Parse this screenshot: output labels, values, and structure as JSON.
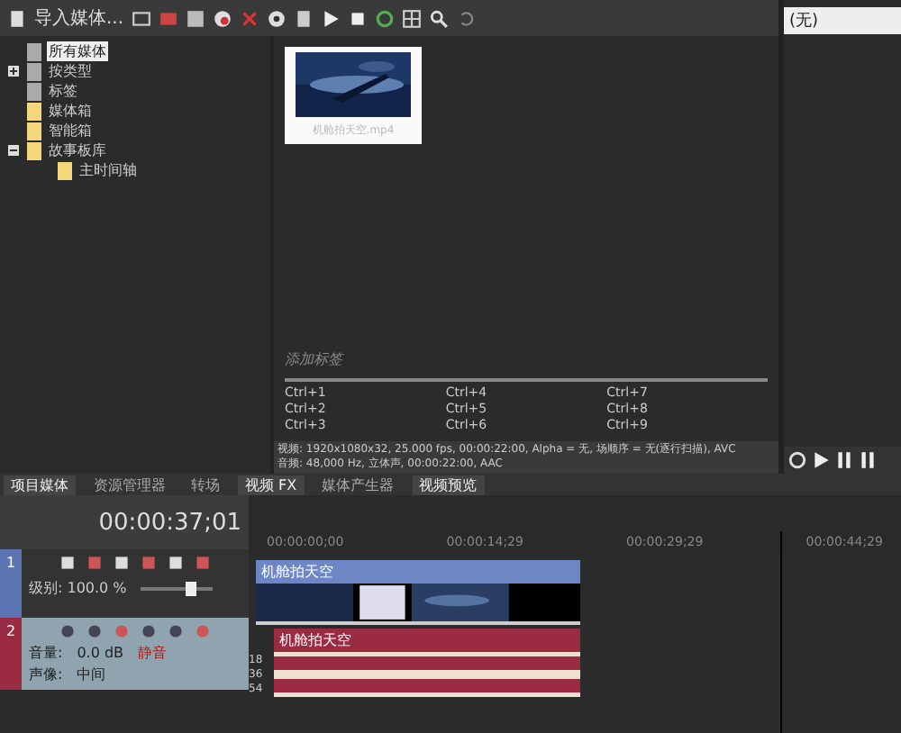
{
  "toolbar": {
    "import_label": "导入媒体..."
  },
  "media_tree": [
    {
      "label": "所有媒体",
      "selected": true
    },
    {
      "label": "按类型",
      "selected": false,
      "expanded": false
    },
    {
      "label": "标签",
      "selected": false
    },
    {
      "label": "媒体箱",
      "selected": false
    },
    {
      "label": "智能箱",
      "selected": false
    },
    {
      "label": "故事板库",
      "selected": false,
      "expanded": true,
      "children": [
        {
          "label": "主时间轴",
          "selected": false
        }
      ]
    }
  ],
  "media_item": {
    "caption": "机舱拍天空.mp4"
  },
  "tags": {
    "placeholder": "添加标签",
    "shortcuts": [
      "Ctrl+1",
      "Ctrl+4",
      "Ctrl+7",
      "Ctrl+2",
      "Ctrl+5",
      "Ctrl+8",
      "Ctrl+3",
      "Ctrl+6",
      "Ctrl+9"
    ]
  },
  "media_info": [
    "视频: 1920x1080x32, 25.000 fps, 00:00:22:00, Alpha = 无, 场顺序 = 无(逐行扫描), AVC",
    "音频: 48,000 Hz, 立体声, 00:00:22:00, AAC"
  ],
  "preview": {
    "value": "(无)"
  },
  "dock_tabs": [
    {
      "label": "项目媒体",
      "selected": true
    },
    {
      "label": "资源管理器",
      "selected": false
    },
    {
      "label": "转场",
      "selected": false
    },
    {
      "label": "视频 FX",
      "selected": true
    },
    {
      "label": "媒体产生器",
      "selected": false
    },
    {
      "label": "视频预览",
      "selected": true
    }
  ],
  "timeline": {
    "timecode": "00:00:37;01",
    "ruler": [
      "00:00:00;00",
      "00:00:14;29",
      "00:00:29;29",
      "00:00:44;29"
    ]
  },
  "tracks": [
    {
      "kind": "video",
      "number": "1",
      "level_label": "级别: 100.0 %",
      "level": 0.7,
      "clip_title": "机舱拍天空"
    },
    {
      "kind": "audio",
      "number": "2",
      "volume_label": "音量:",
      "volume_value": "0.0 dB",
      "pan_label": "声像:",
      "pan_value": "中间",
      "mute_label": "静音",
      "clip_title": "机舱拍天空",
      "meter": [
        "18",
        "36",
        "54"
      ]
    }
  ]
}
